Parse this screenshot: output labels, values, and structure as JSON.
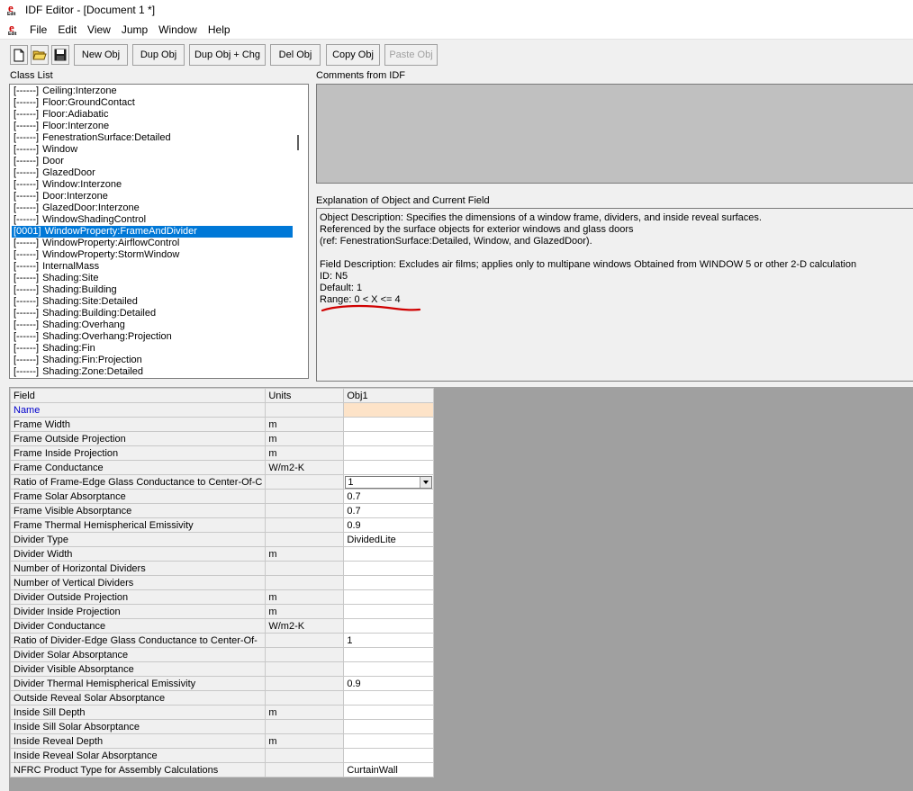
{
  "window": {
    "title": "IDF Editor - [Document 1 *]"
  },
  "menu": [
    "File",
    "Edit",
    "View",
    "Jump",
    "Window",
    "Help"
  ],
  "toolbar": {
    "icons": [
      "new-file-icon",
      "open-folder-icon",
      "save-disk-icon"
    ],
    "buttons": [
      "New Obj",
      "Dup Obj",
      "Dup Obj + Chg",
      "Del Obj",
      "Copy Obj",
      "Paste Obj"
    ]
  },
  "class_list": {
    "label": "Class List",
    "selected_index": 12,
    "items": [
      {
        "count": "[------]",
        "name": "Ceiling:Interzone"
      },
      {
        "count": "[------]",
        "name": "Floor:GroundContact"
      },
      {
        "count": "[------]",
        "name": "Floor:Adiabatic"
      },
      {
        "count": "[------]",
        "name": "Floor:Interzone"
      },
      {
        "count": "[------]",
        "name": "FenestrationSurface:Detailed"
      },
      {
        "count": "[------]",
        "name": "Window"
      },
      {
        "count": "[------]",
        "name": "Door"
      },
      {
        "count": "[------]",
        "name": "GlazedDoor"
      },
      {
        "count": "[------]",
        "name": "Window:Interzone"
      },
      {
        "count": "[------]",
        "name": "Door:Interzone"
      },
      {
        "count": "[------]",
        "name": "GlazedDoor:Interzone"
      },
      {
        "count": "[------]",
        "name": "WindowShadingControl"
      },
      {
        "count": "[0001]",
        "name": "WindowProperty:FrameAndDivider"
      },
      {
        "count": "[------]",
        "name": "WindowProperty:AirflowControl"
      },
      {
        "count": "[------]",
        "name": "WindowProperty:StormWindow"
      },
      {
        "count": "[------]",
        "name": "InternalMass"
      },
      {
        "count": "[------]",
        "name": "Shading:Site"
      },
      {
        "count": "[------]",
        "name": "Shading:Building"
      },
      {
        "count": "[------]",
        "name": "Shading:Site:Detailed"
      },
      {
        "count": "[------]",
        "name": "Shading:Building:Detailed"
      },
      {
        "count": "[------]",
        "name": "Shading:Overhang"
      },
      {
        "count": "[------]",
        "name": "Shading:Overhang:Projection"
      },
      {
        "count": "[------]",
        "name": "Shading:Fin"
      },
      {
        "count": "[------]",
        "name": "Shading:Fin:Projection"
      },
      {
        "count": "[------]",
        "name": "Shading:Zone:Detailed"
      }
    ]
  },
  "comments": {
    "label": "Comments from IDF"
  },
  "explanation": {
    "label": "Explanation of Object and Current Field",
    "lines": [
      "Object Description: Specifies the dimensions of a window frame, dividers, and inside reveal surfaces.",
      "Referenced by the surface objects for exterior windows and glass doors",
      "(ref: FenestrationSurface:Detailed, Window, and GlazedDoor).",
      "",
      "Field Description:  Excludes air films; applies only to multipane windows Obtained from WINDOW 5 or other 2-D calculation",
      "ID: N5",
      "Default: 1",
      "Range: 0 < X <= 4"
    ]
  },
  "grid": {
    "headers": {
      "field": "Field",
      "units": "Units",
      "obj": "Obj1"
    },
    "rows": [
      {
        "field": "Name",
        "units": "",
        "value": ""
      },
      {
        "field": "Frame Width",
        "units": "m",
        "value": ""
      },
      {
        "field": "Frame Outside Projection",
        "units": "m",
        "value": ""
      },
      {
        "field": "Frame Inside Projection",
        "units": "m",
        "value": ""
      },
      {
        "field": "Frame Conductance",
        "units": "W/m2-K",
        "value": ""
      },
      {
        "field": "Ratio of Frame-Edge Glass Conductance to Center-Of-C",
        "units": "",
        "value": "1"
      },
      {
        "field": "Frame Solar Absorptance",
        "units": "",
        "value": "0.7"
      },
      {
        "field": "Frame Visible Absorptance",
        "units": "",
        "value": "0.7"
      },
      {
        "field": "Frame Thermal Hemispherical Emissivity",
        "units": "",
        "value": "0.9"
      },
      {
        "field": "Divider Type",
        "units": "",
        "value": "DividedLite"
      },
      {
        "field": "Divider Width",
        "units": "m",
        "value": ""
      },
      {
        "field": "Number of Horizontal Dividers",
        "units": "",
        "value": ""
      },
      {
        "field": "Number of Vertical Dividers",
        "units": "",
        "value": ""
      },
      {
        "field": "Divider Outside Projection",
        "units": "m",
        "value": ""
      },
      {
        "field": "Divider Inside Projection",
        "units": "m",
        "value": ""
      },
      {
        "field": "Divider Conductance",
        "units": "W/m2-K",
        "value": ""
      },
      {
        "field": "Ratio of Divider-Edge Glass Conductance to Center-Of-",
        "units": "",
        "value": "1"
      },
      {
        "field": "Divider Solar Absorptance",
        "units": "",
        "value": ""
      },
      {
        "field": "Divider Visible Absorptance",
        "units": "",
        "value": ""
      },
      {
        "field": "Divider Thermal Hemispherical Emissivity",
        "units": "",
        "value": "0.9"
      },
      {
        "field": "Outside Reveal Solar Absorptance",
        "units": "",
        "value": ""
      },
      {
        "field": "Inside Sill Depth",
        "units": "m",
        "value": ""
      },
      {
        "field": "Inside Sill Solar Absorptance",
        "units": "",
        "value": ""
      },
      {
        "field": "Inside Reveal Depth",
        "units": "m",
        "value": ""
      },
      {
        "field": "Inside Reveal Solar Absorptance",
        "units": "",
        "value": ""
      },
      {
        "field": "NFRC Product Type for Assembly Calculations",
        "units": "",
        "value": "CurtainWall"
      }
    ]
  },
  "colors": {
    "selection": "#0078d7",
    "name_field": "#0000cc",
    "name_value_highlight": "#fde3c8",
    "annotation": "#d00000"
  }
}
